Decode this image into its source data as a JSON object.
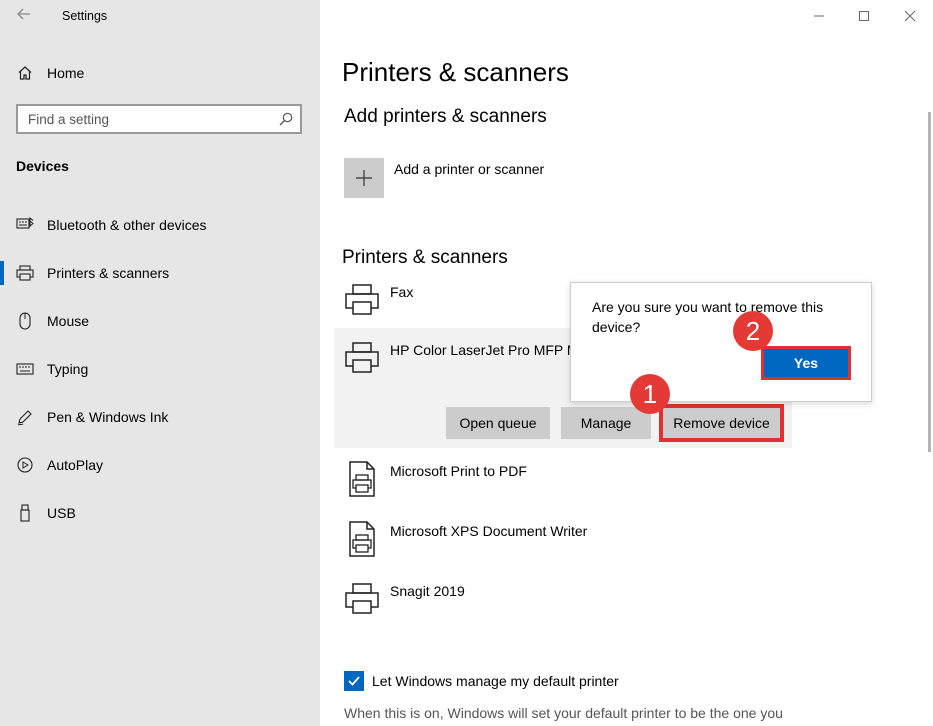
{
  "app": {
    "title": "Settings"
  },
  "sidebar": {
    "home_label": "Home",
    "search_placeholder": "Find a setting",
    "section": "Devices",
    "items": [
      {
        "label": "Bluetooth & other devices",
        "icon": "bluetooth-keyboard-icon"
      },
      {
        "label": "Printers & scanners",
        "icon": "printer-icon",
        "active": true
      },
      {
        "label": "Mouse",
        "icon": "mouse-icon"
      },
      {
        "label": "Typing",
        "icon": "keyboard-icon"
      },
      {
        "label": "Pen & Windows Ink",
        "icon": "pen-icon"
      },
      {
        "label": "AutoPlay",
        "icon": "autoplay-icon"
      },
      {
        "label": "USB",
        "icon": "usb-icon"
      }
    ]
  },
  "main": {
    "title": "Printers & scanners",
    "add_heading": "Add printers & scanners",
    "add_label": "Add a printer or scanner",
    "list_heading": "Printers & scanners",
    "printers": [
      {
        "name": "Fax"
      },
      {
        "name": "HP Color LaserJet Pro MFP M"
      },
      {
        "name": "Microsoft Print to PDF"
      },
      {
        "name": "Microsoft XPS Document Writer"
      },
      {
        "name": "Snagit 2019"
      }
    ],
    "buttons": {
      "open_queue": "Open queue",
      "manage": "Manage",
      "remove": "Remove device"
    },
    "dialog": {
      "message": "Are you sure you want to remove this device?",
      "yes": "Yes"
    },
    "badges": {
      "step1": "1",
      "step2": "2"
    },
    "default_printer": {
      "label": "Let Windows manage my default printer",
      "checked": true,
      "description": "When this is on, Windows will set your default printer to be the one you"
    }
  },
  "colors": {
    "accent": "#0067c0",
    "highlight": "#e03030",
    "sidebar_bg": "#e6e6e6"
  }
}
